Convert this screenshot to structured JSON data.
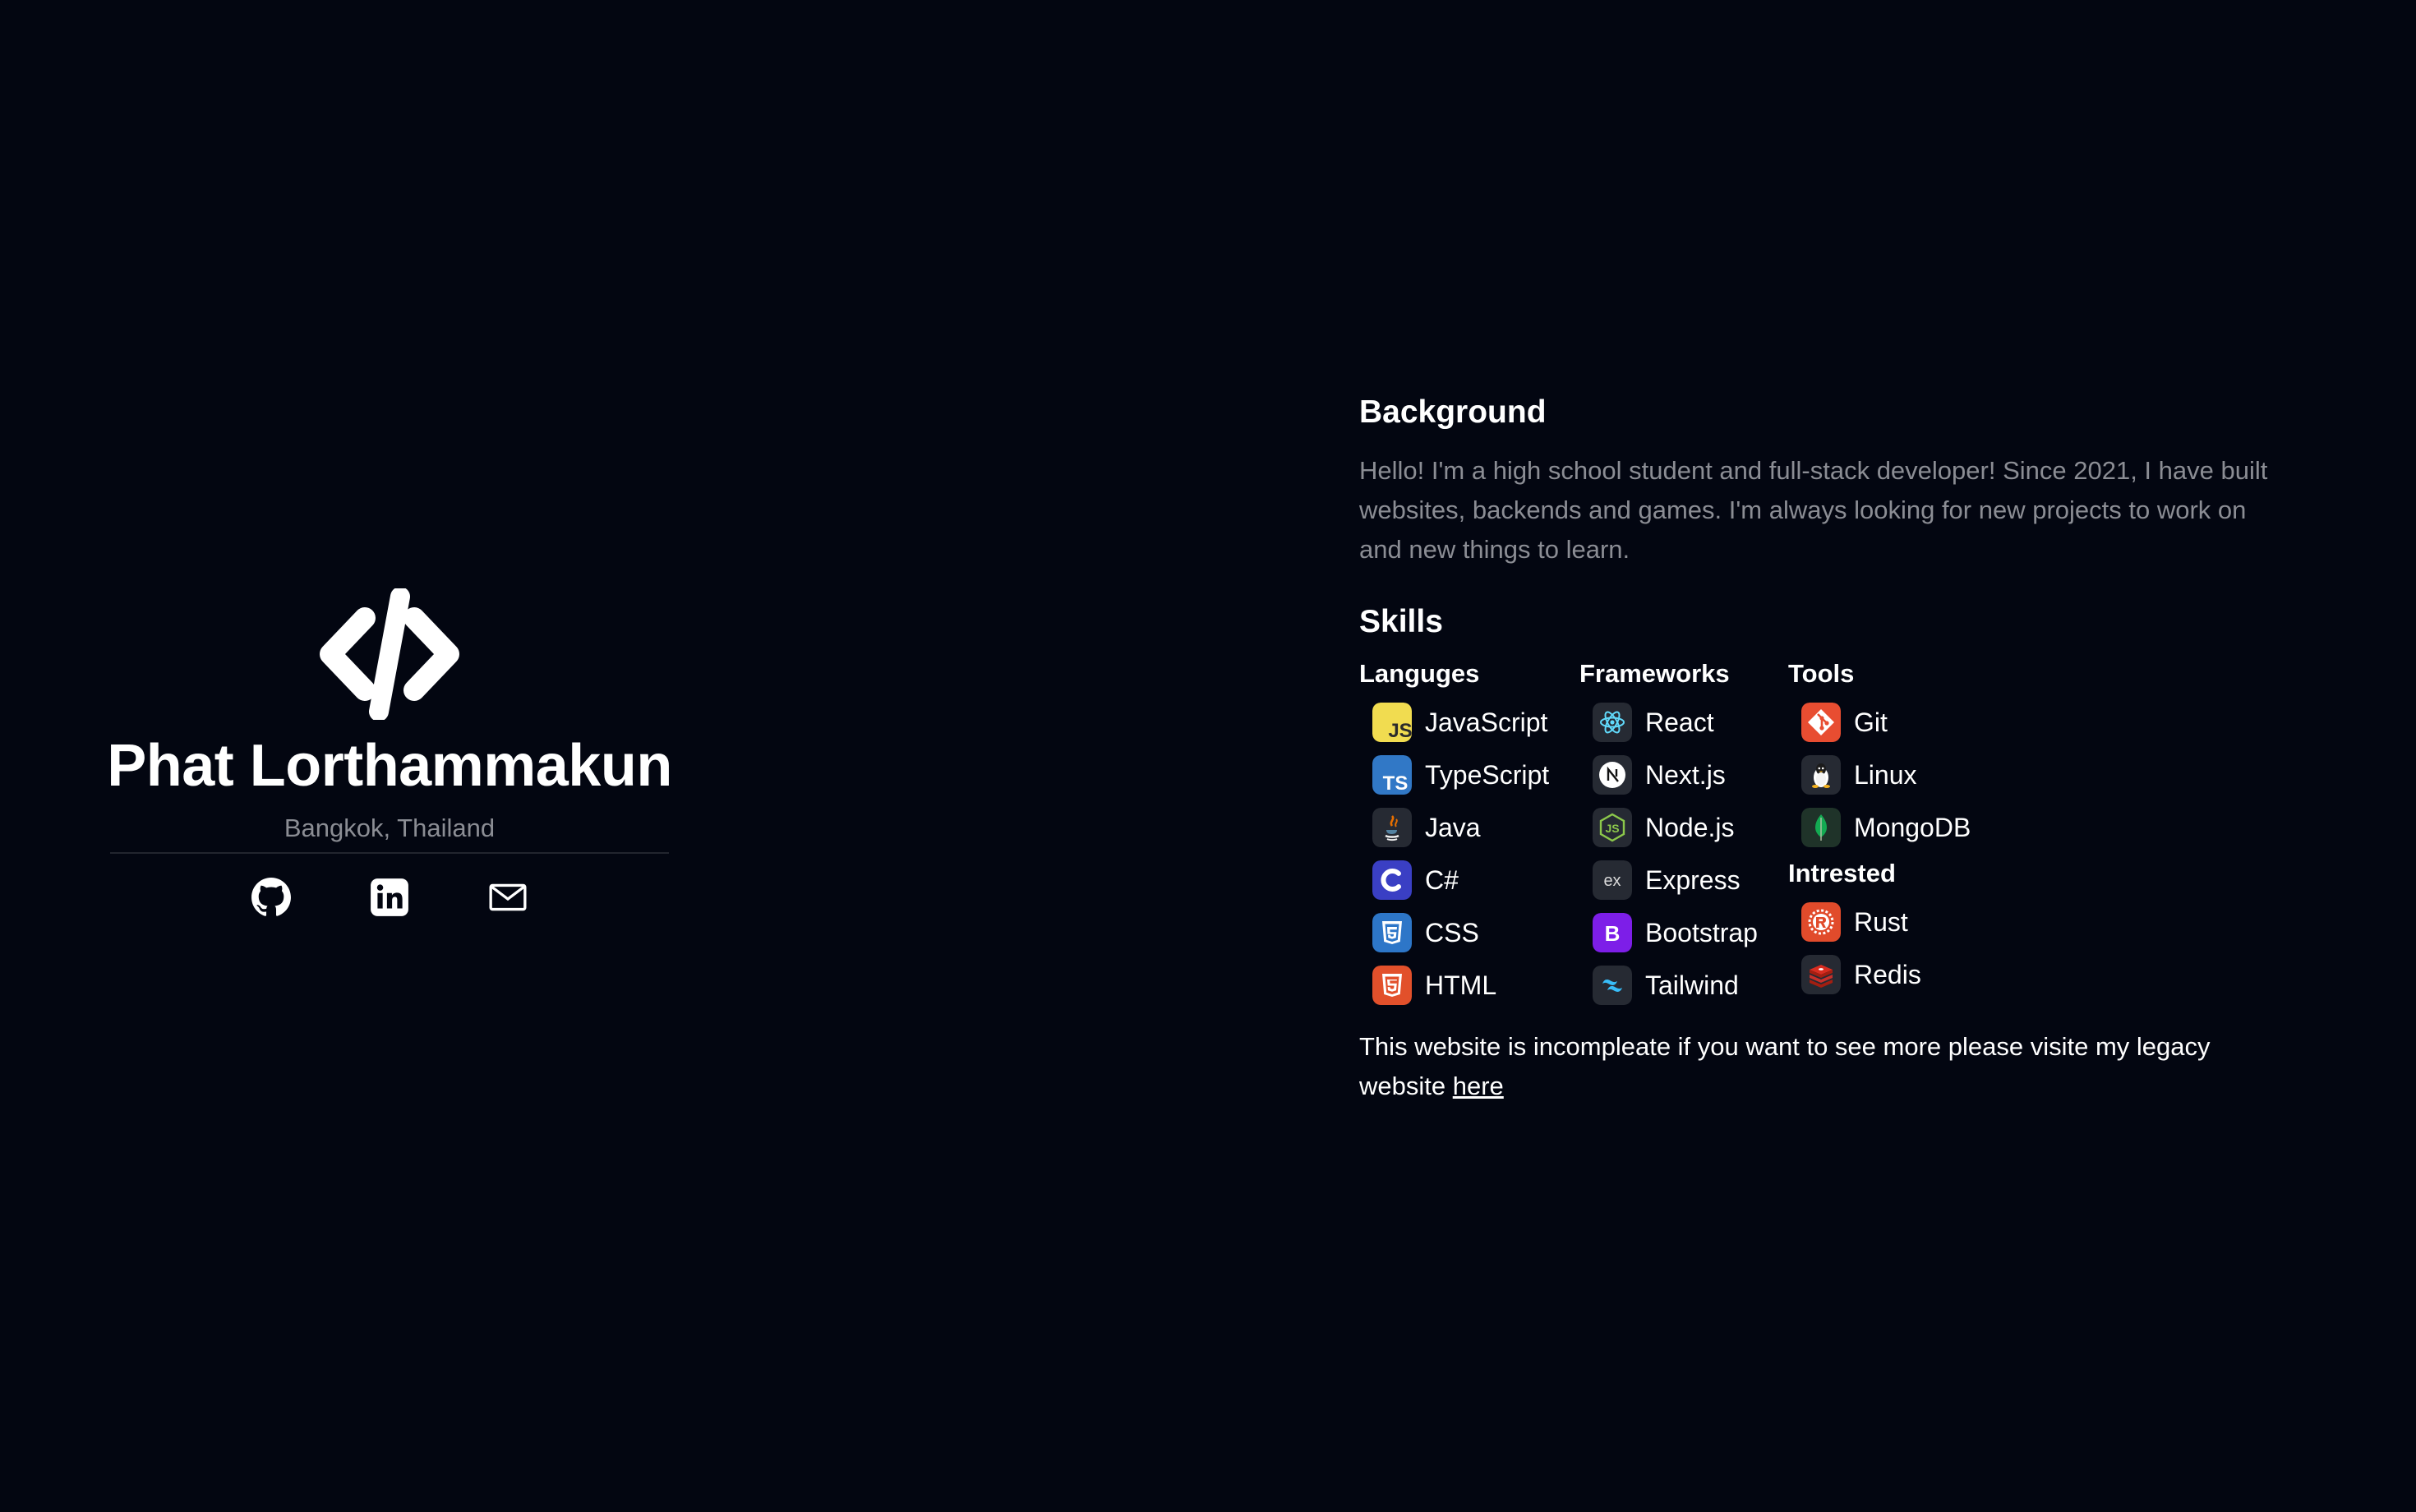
{
  "profile": {
    "name": "Phat Lorthammakun",
    "location": "Bangkok, Thailand",
    "logo_icon": "code-slash-icon",
    "socials": [
      {
        "icon": "github-icon"
      },
      {
        "icon": "linkedin-icon"
      },
      {
        "icon": "mail-icon"
      }
    ]
  },
  "background": {
    "title": "Background",
    "text": "Hello! I'm a high school student and full-stack developer! Since 2021, I have built websites, backends and games. I'm always looking for new projects to work on and new things to learn."
  },
  "skills": {
    "title": "Skills",
    "languages": {
      "title": "Languges",
      "items": [
        {
          "label": "JavaScript",
          "icon": "javascript-icon"
        },
        {
          "label": "TypeScript",
          "icon": "typescript-icon"
        },
        {
          "label": "Java",
          "icon": "java-icon"
        },
        {
          "label": "C#",
          "icon": "csharp-icon"
        },
        {
          "label": "CSS",
          "icon": "css-icon"
        },
        {
          "label": "HTML",
          "icon": "html-icon"
        }
      ]
    },
    "frameworks": {
      "title": "Frameworks",
      "items": [
        {
          "label": "React",
          "icon": "react-icon"
        },
        {
          "label": "Next.js",
          "icon": "nextjs-icon"
        },
        {
          "label": "Node.js",
          "icon": "nodejs-icon"
        },
        {
          "label": "Express",
          "icon": "express-icon"
        },
        {
          "label": "Bootstrap",
          "icon": "bootstrap-icon"
        },
        {
          "label": "Tailwind",
          "icon": "tailwind-icon"
        }
      ]
    },
    "tools": {
      "title": "Tools",
      "items": [
        {
          "label": "Git",
          "icon": "git-icon"
        },
        {
          "label": "Linux",
          "icon": "linux-icon"
        },
        {
          "label": "MongoDB",
          "icon": "mongodb-icon"
        }
      ]
    },
    "interested": {
      "title": "Intrested",
      "items": [
        {
          "label": "Rust",
          "icon": "rust-icon"
        },
        {
          "label": "Redis",
          "icon": "redis-icon"
        }
      ]
    }
  },
  "footer": {
    "text": "This website is incompleate if you want to see more please visite my legacy website ",
    "link_label": "here"
  },
  "colors": {
    "background": "#030611",
    "muted_text": "#8b8d94",
    "text": "#ffffff"
  }
}
